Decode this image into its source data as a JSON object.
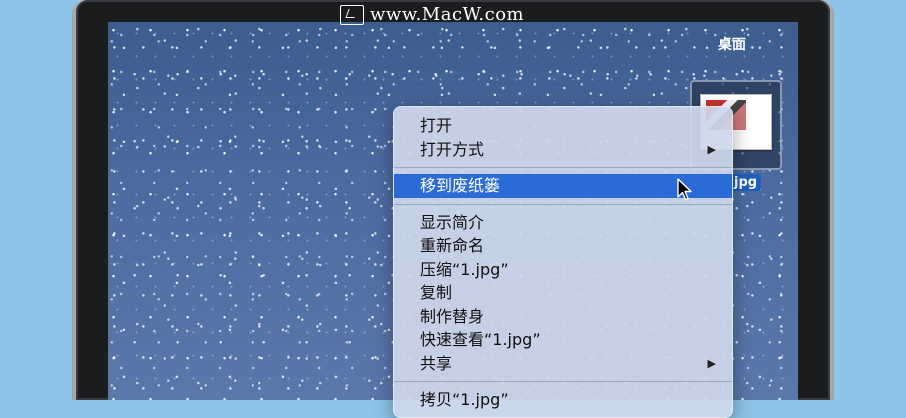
{
  "watermark": {
    "text": "www.MacW.com",
    "icon": "macw-logo-icon"
  },
  "desktop": {
    "label": "桌面",
    "file_caption": "jpg"
  },
  "context_menu": {
    "group1": [
      {
        "label": "打开",
        "submenu": false
      },
      {
        "label": "打开方式",
        "submenu": true
      }
    ],
    "group2": [
      {
        "label": "移到废纸篓",
        "highlighted": true
      }
    ],
    "group3": [
      {
        "label": "显示简介",
        "submenu": false
      },
      {
        "label": "重新命名",
        "submenu": false
      },
      {
        "label": "压缩“1.jpg”",
        "submenu": false
      },
      {
        "label": "复制",
        "submenu": false
      },
      {
        "label": "制作替身",
        "submenu": false
      },
      {
        "label": "快速查看“1.jpg”",
        "submenu": false
      },
      {
        "label": "共享",
        "submenu": true
      }
    ],
    "group4": [
      {
        "label": "拷贝“1.jpg”",
        "submenu": false
      }
    ],
    "submenu_arrow": "▶"
  },
  "colors": {
    "highlight": "#2a6bd6",
    "desktop_bg": "#4a6aa0",
    "page_bg": "#8ec4e8"
  }
}
